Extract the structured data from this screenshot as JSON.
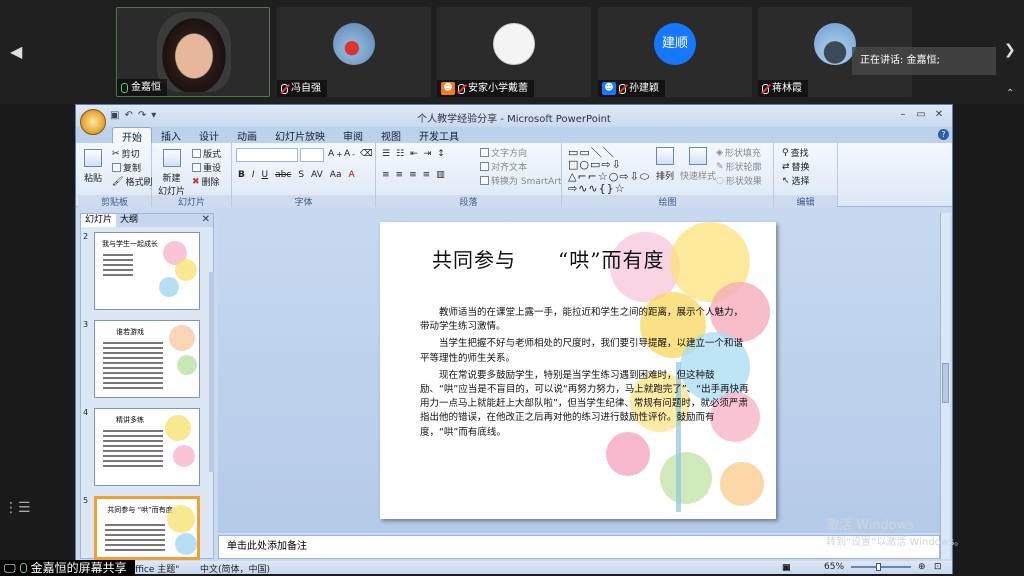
{
  "meeting": {
    "participants": [
      {
        "name": "金嘉恒",
        "mic": "on",
        "active": true
      },
      {
        "name": "冯自强",
        "mic": "off"
      },
      {
        "name": "安家小学戴蕾",
        "mic": "off",
        "badge": "orange"
      },
      {
        "name": "孙建颖",
        "mic": "off",
        "badge": "blue",
        "avatar_text": "建顺"
      },
      {
        "name": "蒋林霞",
        "mic": "off"
      }
    ],
    "speaking_label": "正在讲话: 金嘉恒;",
    "share_label": "金嘉恒的屏幕共享",
    "icons": {
      "prev": "chevron-left-icon",
      "next": "chevron-right-icon",
      "collapse": "collapse-icon",
      "menu": "menu-icon"
    }
  },
  "ppt": {
    "window_title": "个人教学经验分享 - Microsoft PowerPoint",
    "tabs": [
      "开始",
      "插入",
      "设计",
      "动画",
      "幻灯片放映",
      "审阅",
      "视图",
      "开发工具"
    ],
    "ribbon": {
      "clipboard": {
        "paste": "粘贴",
        "cut": "剪切",
        "copy": "复制",
        "format_painter": "格式刷",
        "label": "剪贴板"
      },
      "slides": {
        "new_slide": "新建\n幻灯片",
        "layout": "版式",
        "reset": "重设",
        "delete": "删除",
        "label": "幻灯片"
      },
      "font": {
        "label": "字体"
      },
      "paragraph": {
        "text_direction": "文字方向",
        "align_text": "对齐文本",
        "smartart": "转换为 SmartArt",
        "label": "段落"
      },
      "drawing": {
        "arrange": "排列",
        "quick_styles": "快速样式",
        "shape_fill": "形状填充",
        "shape_outline": "形状轮廓",
        "shape_effects": "形状效果",
        "label": "绘图"
      },
      "editing": {
        "find": "查找",
        "replace": "替换",
        "select": "选择",
        "label": "编辑"
      }
    },
    "pane_tabs": [
      "幻灯片",
      "大纲"
    ],
    "thumbnails": [
      {
        "num": "2",
        "title": "我与学生一起成长"
      },
      {
        "num": "3",
        "title": "谁若游戏"
      },
      {
        "num": "4",
        "title": "精讲多练"
      },
      {
        "num": "5",
        "title": "共同参与 “哄”而有度"
      }
    ],
    "slide": {
      "title": "共同参与　　“哄”而有度",
      "paragraphs": [
        "教师适当的在课堂上露一手，能拉近和学生之间的距离，展示个人魅力，带动学生练习激情。",
        "当学生把握不好与老师相处的尺度时，我们要引导提醒，以建立一个和谐平等理性的师生关系。",
        "现在常说要多鼓励学生，特别是当学生练习遇到困难时，但这种鼓励、“哄”应当是不盲目的，可以说“再努力努力，马上就跑完了”、“出手再快再用力一点马上就能赶上大部队啦”，但当学生纪律、常规有问题时，就必须严肃指出他的错误，在他改正之后再对他的练习进行鼓励性评价。鼓励而有度，“哄”而有底线。"
      ]
    },
    "notes_placeholder": "单击此处添加备注",
    "status": {
      "theme": "\"Office 主题\"",
      "language": "中文(简体，中国)",
      "zoom": "65%"
    }
  },
  "watermark": {
    "line1": "激活 Windows",
    "line2": "转到“设置”以激活 Windows。"
  }
}
